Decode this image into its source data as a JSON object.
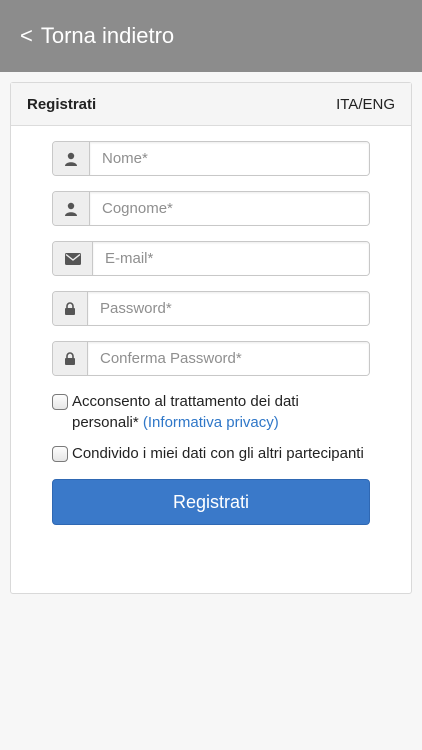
{
  "nav": {
    "back_chevron": "<",
    "back_label": "Torna indietro",
    "background": "#8c8c8c"
  },
  "panel": {
    "title": "Registrati",
    "lang_switch": "ITA/ENG"
  },
  "form": {
    "fields": [
      {
        "icon": "user-icon",
        "placeholder": "Nome*",
        "value": ""
      },
      {
        "icon": "user-icon",
        "placeholder": "Cognome*",
        "value": ""
      },
      {
        "icon": "envelope-icon",
        "placeholder": "E-mail*",
        "value": ""
      },
      {
        "icon": "lock-icon",
        "placeholder": "Password*",
        "value": ""
      },
      {
        "icon": "lock-icon",
        "placeholder": "Conferma Password*",
        "value": ""
      }
    ],
    "consent": {
      "text": "Acconsento al trattamento dei dati personali* ",
      "link": "(Informativa privacy)",
      "checked": false
    },
    "share": {
      "text": "Condivido i miei dati con gli altri partecipanti",
      "checked": false
    },
    "submit_label": "Registrati",
    "accent": "#3a79c9",
    "link_color": "#2f77c8"
  }
}
